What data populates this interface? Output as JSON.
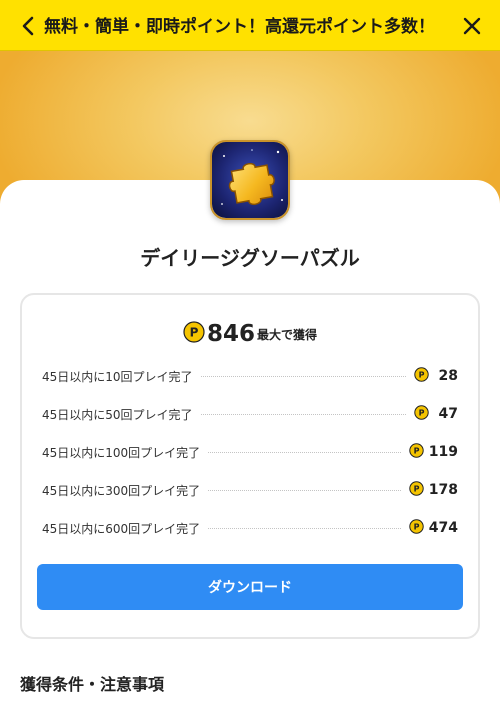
{
  "header": {
    "title": "無料・簡単・即時ポイント！高還元ポイント多数！",
    "back_icon": "chevron-left-icon",
    "close_icon": "close-icon",
    "bg_color": "#ffe100"
  },
  "app": {
    "name": "デイリージグソーパズル",
    "icon": "jigsaw-puzzle-icon"
  },
  "reward": {
    "coin_symbol": "P",
    "coin_color": "#f5c400",
    "total": "846",
    "total_suffix": "最大で獲得",
    "items": [
      {
        "label": "45日以内に10回プレイ完了",
        "points": "28"
      },
      {
        "label": "45日以内に50回プレイ完了",
        "points": "47"
      },
      {
        "label": "45日以内に100回プレイ完了",
        "points": "119"
      },
      {
        "label": "45日以内に300回プレイ完了",
        "points": "178"
      },
      {
        "label": "45日以内に600回プレイ完了",
        "points": "474"
      }
    ]
  },
  "actions": {
    "download_label": "ダウンロード",
    "download_color": "#2f8cf4"
  },
  "section": {
    "conditions_title": "獲得条件・注意事項"
  }
}
